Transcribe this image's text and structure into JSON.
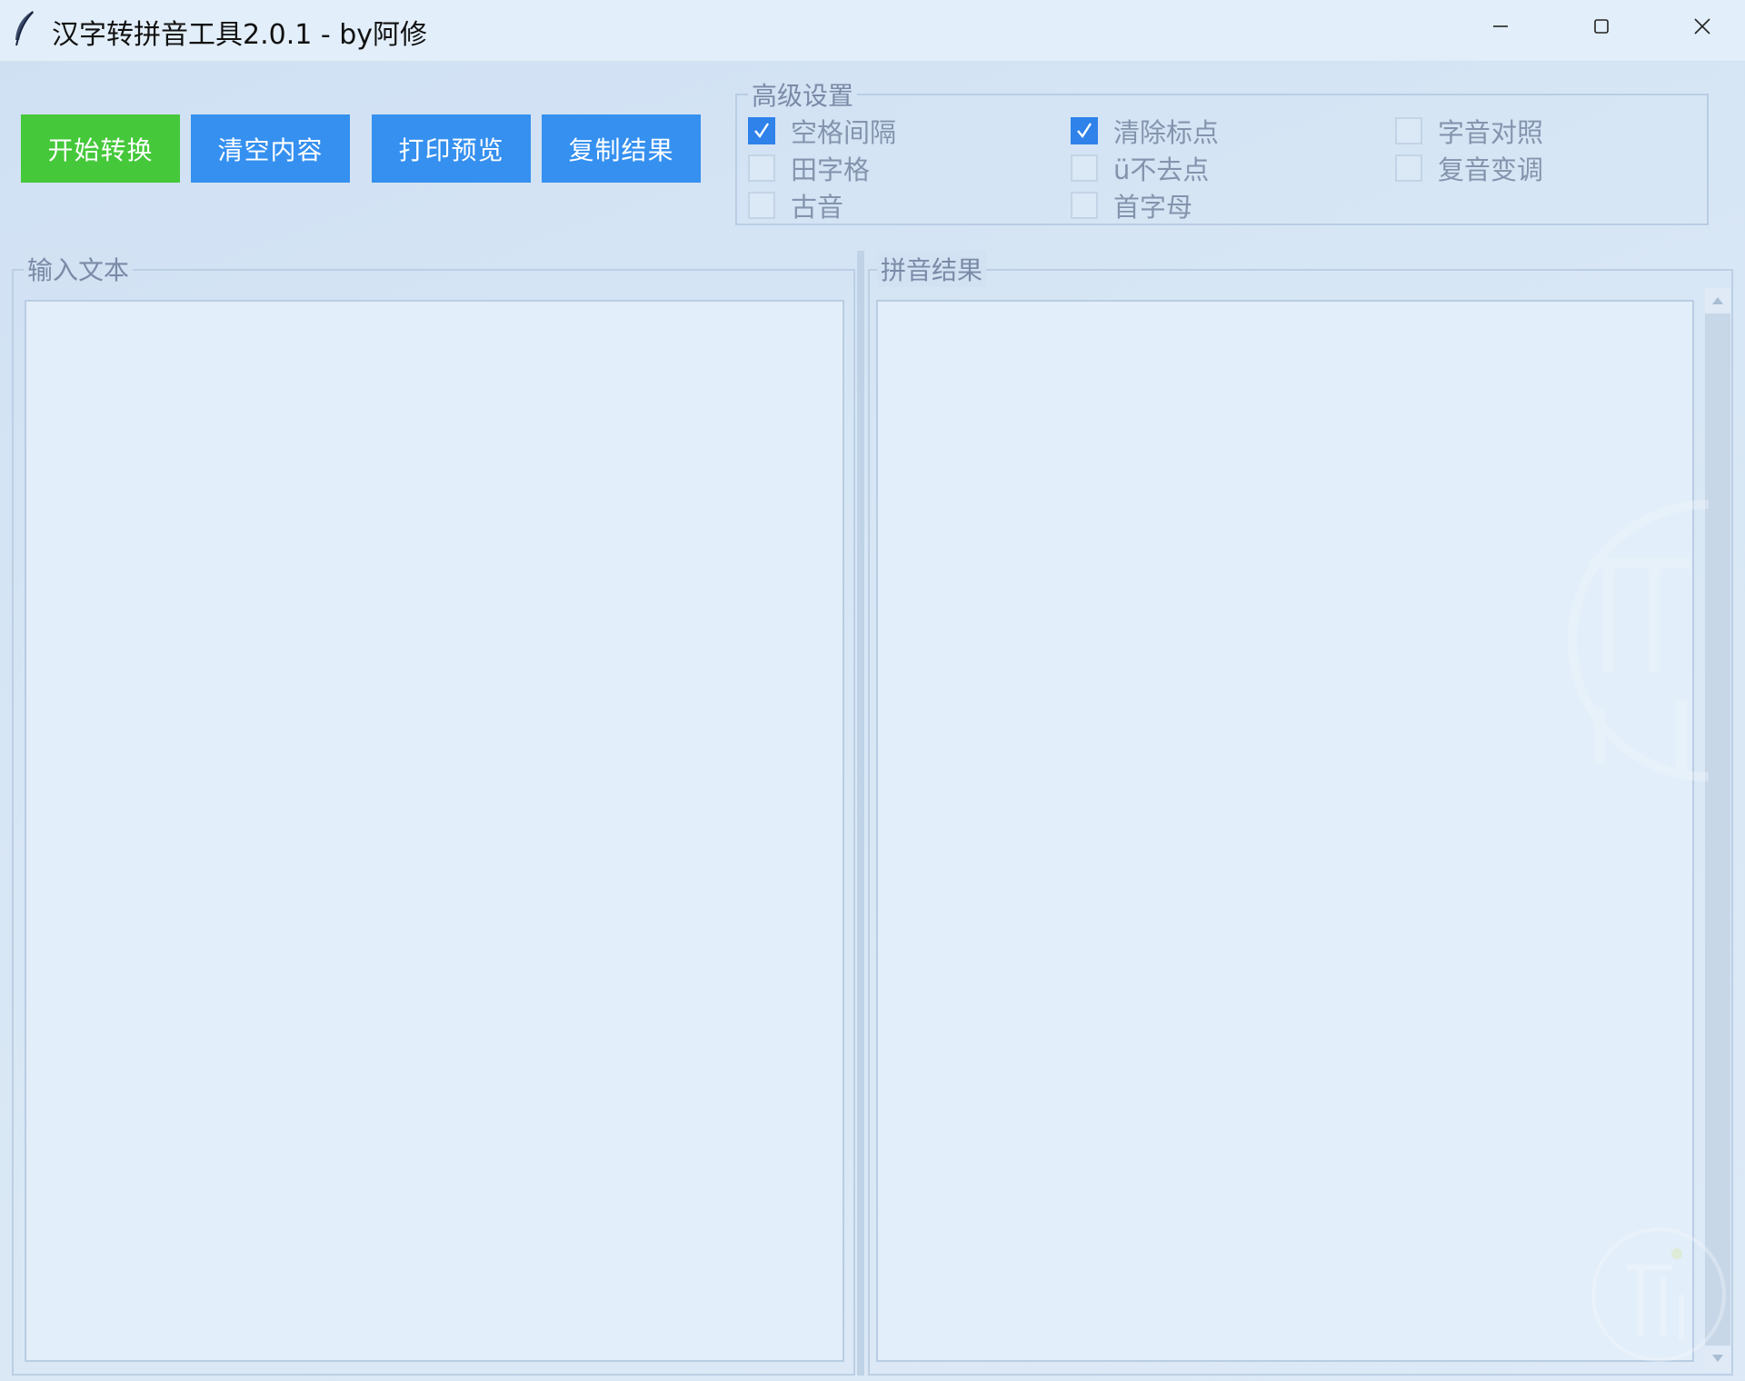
{
  "window": {
    "title": "汉字转拼音工具2.0.1 - by阿修",
    "app_icon": "feather-icon",
    "controls": [
      "minimize-icon",
      "maximize-icon",
      "close-icon"
    ]
  },
  "toolbar": {
    "start_label": "开始转换",
    "clear_label": "清空内容",
    "print_label": "打印预览",
    "copy_label": "复制结果"
  },
  "advanced": {
    "title": "高级设置",
    "options": {
      "space_gap": {
        "label": "空格间隔",
        "checked": true
      },
      "remove_punct": {
        "label": "清除标点",
        "checked": true
      },
      "char_pinyin": {
        "label": "字音对照",
        "checked": false
      },
      "tian_grid": {
        "label": "田字格",
        "checked": false
      },
      "u_no_dots": {
        "label": "ü不去点",
        "checked": false
      },
      "polyphone_tone": {
        "label": "复音变调",
        "checked": false
      },
      "ancient": {
        "label": "古音",
        "checked": false
      },
      "initials": {
        "label": "首字母",
        "checked": false
      }
    }
  },
  "panels": {
    "input_title": "输入文本",
    "input_value": "",
    "output_title": "拼音结果",
    "output_value": ""
  },
  "colors": {
    "start_button": "#45c83a",
    "action_button": "#3590f0",
    "checkbox_checked": "#2e82ea"
  }
}
